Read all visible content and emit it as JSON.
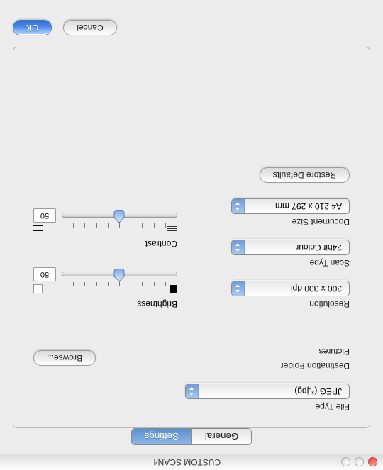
{
  "window": {
    "title": "CUSTOM SCAN4"
  },
  "tabs": {
    "general": "General",
    "settings": "Settings"
  },
  "fileType": {
    "label": "File Type",
    "value": "JPEG (*.jpg)"
  },
  "destination": {
    "label": "Destination Folder",
    "folder": "Pictures",
    "browse": "Browse..."
  },
  "resolution": {
    "label": "Resolution",
    "value": "300 x 300 dpi"
  },
  "scanType": {
    "label": "Scan Type",
    "value": "24bit Colour"
  },
  "docSize": {
    "label": "Document Size",
    "value": "A4 210 x 297 mm"
  },
  "brightness": {
    "label": "Brightness",
    "value": "50"
  },
  "contrast": {
    "label": "Contrast",
    "value": "50"
  },
  "restore": "Restore Defaults",
  "cancel": "Cancel",
  "ok": "OK"
}
